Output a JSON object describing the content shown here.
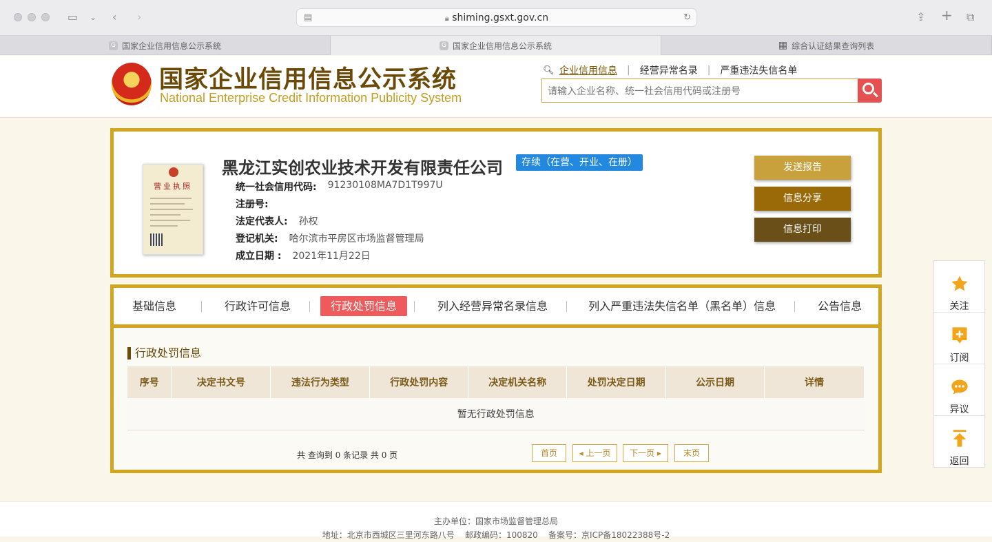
{
  "browser": {
    "url": "shiming.gsxt.gov.cn",
    "tabs": [
      {
        "label": "国家企业信用信息公示系统",
        "icon": "G"
      },
      {
        "label": "国家企业信用信息公示系统",
        "icon": "G"
      },
      {
        "label": "综合认证结果查询列表",
        "icon": "grid-icon"
      }
    ]
  },
  "header": {
    "title_cn": "国家企业信用信息公示系统",
    "title_en": "National Enterprise Credit Information Publicity System",
    "links": [
      "企业信用信息",
      "经营异常名录",
      "严重违法失信名单"
    ],
    "search_placeholder": "请输入企业名称、统一社会信用代码或注册号"
  },
  "company": {
    "license_title": "营业执照",
    "name": "黑龙江实创农业技术开发有限责任公司",
    "status": "存续（在营、开业、在册）",
    "fields": [
      {
        "label": "统一社会信用代码:",
        "value": "91230108MA7D1T997U"
      },
      {
        "label": "注册号:",
        "value": ""
      },
      {
        "label": "法定代表人:",
        "value": "孙权"
      },
      {
        "label": "登记机关:",
        "value": "哈尔滨市平房区市场监督管理局"
      },
      {
        "label": "成立日期 :",
        "value": "2021年11月22日"
      }
    ],
    "actions": [
      "发送报告",
      "信息分享",
      "信息打印"
    ],
    "action_colors": [
      "#c9a13c",
      "#9a6a08",
      "#6b4f18"
    ]
  },
  "tabs": [
    "基础信息",
    "行政许可信息",
    "行政处罚信息",
    "列入经营异常名录信息",
    "列入严重违法失信名单（黑名单）信息",
    "公告信息"
  ],
  "section": {
    "title": "行政处罚信息",
    "columns": [
      "序号",
      "决定书文号",
      "违法行为类型",
      "行政处罚内容",
      "决定机关名称",
      "处罚决定日期",
      "公示日期",
      "详情"
    ],
    "empty_text": "暂无行政处罚信息",
    "pager_info": "共 查询到 0 条记录 共 0 页",
    "pager": [
      "首页",
      "上一页",
      "下一页",
      "末页"
    ]
  },
  "float": [
    "关注",
    "订阅",
    "异议",
    "返回"
  ],
  "footer": {
    "line1": "主办单位：国家市场监督管理总局",
    "line2": "地址：北京市西城区三里河东路八号    邮政编码：100820    备案号：京ICP备18022388号-2"
  }
}
